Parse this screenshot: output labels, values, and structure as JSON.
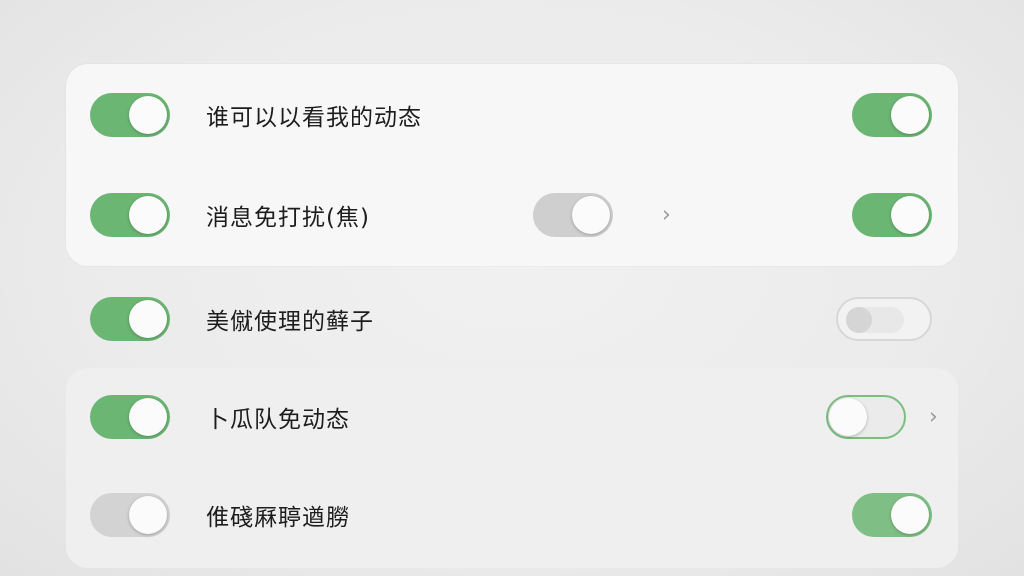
{
  "settings": {
    "rows": [
      {
        "label": "谁可以以看我的动态",
        "left_toggle": "on",
        "right_toggle": "on"
      },
      {
        "label": "消息免打扰(焦)",
        "left_toggle": "on",
        "middle_toggle": "off",
        "chevron": "chevron-right-icon",
        "right_toggle": "on"
      },
      {
        "label": "美僦使理的藓子",
        "left_toggle": "on",
        "right_toggle": "off"
      },
      {
        "label": "卜瓜队免动态",
        "left_toggle": "on",
        "right_toggle": "off",
        "chevron": "chevron-right-icon"
      },
      {
        "label": "倠碊厤聤遒朥",
        "left_toggle": "off",
        "right_toggle": "on"
      }
    ]
  },
  "colors": {
    "toggle_on": "#6bb673",
    "toggle_off": "#cfcfcf",
    "card_background": "#f7f7f7",
    "page_background": "#ebebeb"
  },
  "chevron_glyph": "›"
}
